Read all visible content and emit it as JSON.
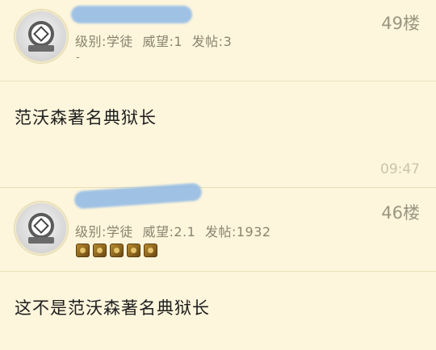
{
  "posts": [
    {
      "meta": {
        "level": "级别:学徒",
        "prestige": "威望:1",
        "posts_count": "发帖:3"
      },
      "floor": "49楼",
      "sub_mark": "-",
      "content": "范沃森著名典狱长",
      "time": "09:47"
    },
    {
      "meta": {
        "level": "级别:学徒",
        "prestige": "威望:2.1",
        "posts_count": "发帖:1932"
      },
      "floor": "46楼",
      "badges": [
        "medal-icon",
        "medal-icon",
        "medal-icon",
        "medal-icon",
        "medal-icon"
      ],
      "content": "这不是范沃森著名典狱长"
    }
  ],
  "colors": {
    "background": "#fdf6dc",
    "username_blur": "#8fb8e6",
    "meta_text": "#8a8470"
  }
}
